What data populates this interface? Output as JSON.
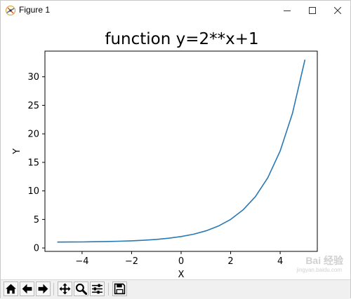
{
  "window": {
    "title": "Figure 1"
  },
  "title_bar_buttons": [
    "minimize-icon",
    "maximize-icon",
    "close-icon"
  ],
  "toolbar": {
    "buttons": [
      "home-icon",
      "back-arrow-icon",
      "forward-arrow-icon",
      "pan-move-icon",
      "zoom-magnifier-icon",
      "configure-subplots-icon",
      "save-floppy-icon"
    ]
  },
  "watermark": {
    "text": "Bai 经验",
    "sub": "jingyan.baidu.com"
  },
  "colors": {
    "line": "#2878b5",
    "axis": "#000000"
  },
  "chart_data": {
    "type": "line",
    "title": "function y=2**x+1",
    "xlabel": "X",
    "ylabel": "Y",
    "xlim": [
      -5.5,
      5.5
    ],
    "ylim": [
      -0.6,
      34.5
    ],
    "xticks": [
      -4,
      -2,
      0,
      2,
      4
    ],
    "xtick_labels": [
      "−4",
      "−2",
      "0",
      "2",
      "4"
    ],
    "yticks": [
      0,
      5,
      10,
      15,
      20,
      25,
      30
    ],
    "ytick_labels": [
      "0",
      "5",
      "10",
      "15",
      "20",
      "25",
      "30"
    ],
    "grid": false,
    "series": [
      {
        "x": [
          -5,
          -4.5,
          -4,
          -3.5,
          -3,
          -2.5,
          -2,
          -1.5,
          -1,
          -0.5,
          0,
          0.5,
          1,
          1.5,
          2,
          2.5,
          3,
          3.5,
          4,
          4.5,
          5
        ],
        "values": [
          1.03,
          1.04,
          1.06,
          1.09,
          1.13,
          1.18,
          1.25,
          1.35,
          1.5,
          1.71,
          2,
          2.41,
          3,
          3.83,
          5,
          6.66,
          9,
          12.31,
          17,
          23.63,
          33
        ]
      }
    ]
  }
}
